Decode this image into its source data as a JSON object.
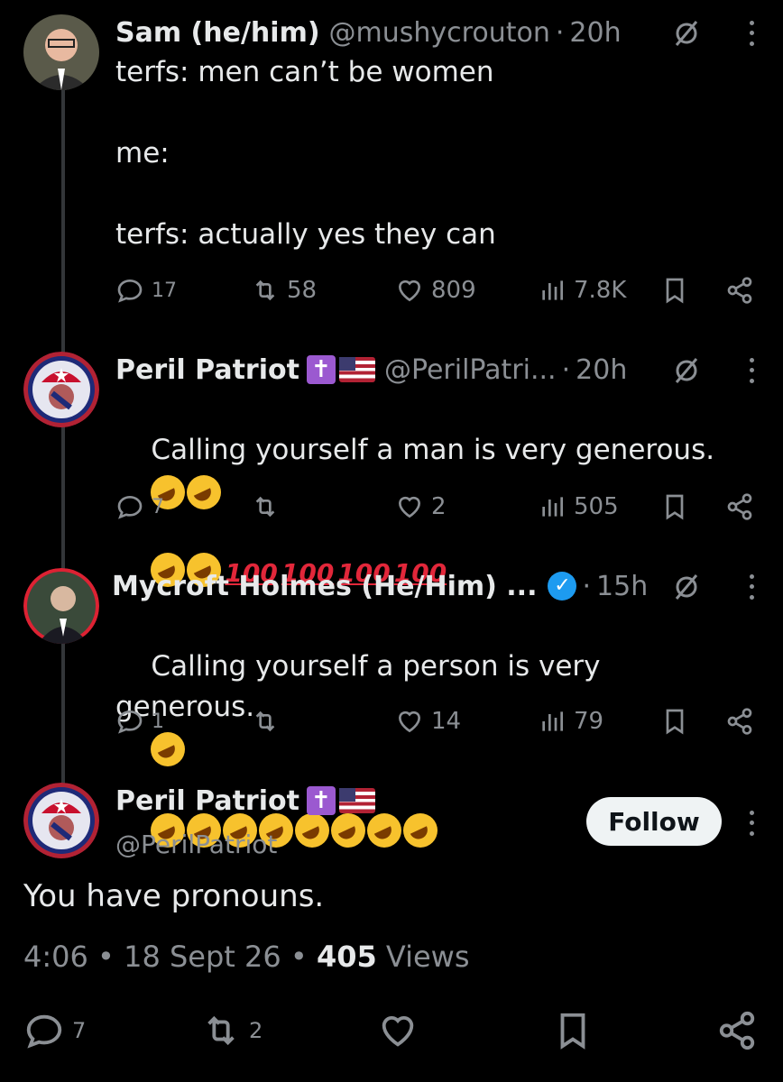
{
  "tweets": [
    {
      "name": "Sam (he/him)",
      "handle": "@mushycrouton",
      "time": "20h",
      "text": "terfs: men can’t be women\n\nme:\n\nterfs: actually yes they can",
      "replies": "17",
      "retweets": "58",
      "likes": "809",
      "views": "7.8K"
    },
    {
      "name": "Peril Patriot",
      "handle": "@PerilPatri...",
      "time": "20h",
      "text": "Calling yourself a man is very generous.",
      "hundred": "100",
      "replies": "7",
      "retweets": "",
      "likes": "2",
      "views": "505"
    },
    {
      "name": "Mycroft Holmes (He/Him) ...",
      "time": "15h",
      "text": "Calling yourself a person is very generous.",
      "replies": "1",
      "retweets": "",
      "likes": "14",
      "views": "79"
    }
  ],
  "main": {
    "name": "Peril Patriot",
    "handle": "@PerilPatriot",
    "follow_label": "Follow",
    "text": "You have pronouns.",
    "time": "4:06",
    "date": "18 Sept 26",
    "views_count": "405",
    "views_label": "Views",
    "replies": "7",
    "retweets": "2"
  },
  "dot": "·",
  "bullet": "•",
  "colors": {
    "accent": "#1d9bf0",
    "muted": "#8b8f94",
    "bg": "#000000"
  }
}
